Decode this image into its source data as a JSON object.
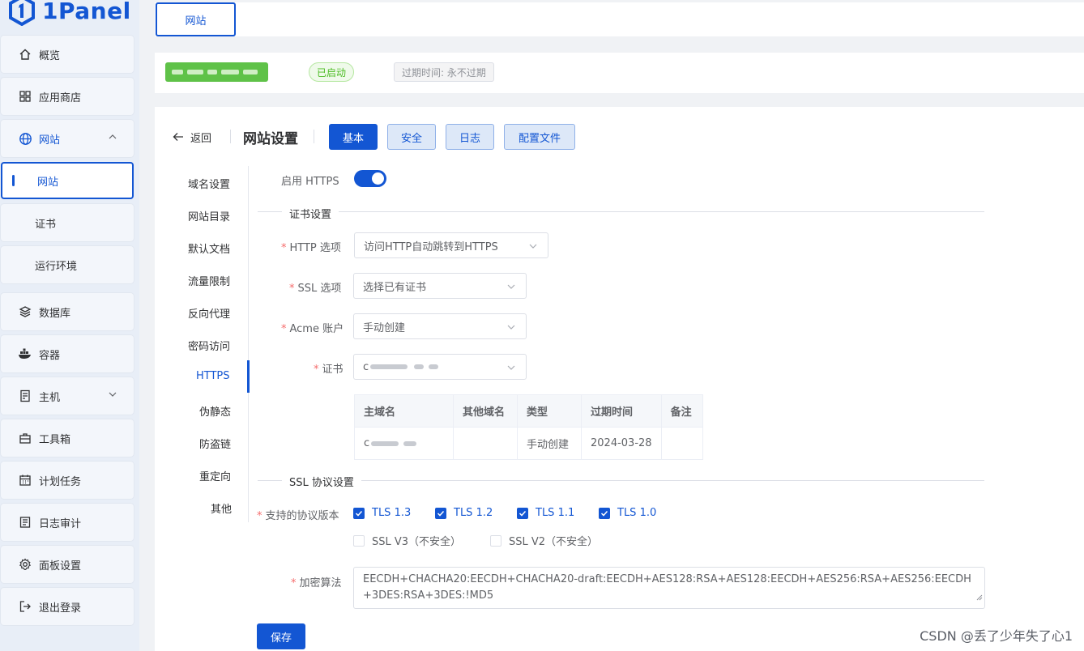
{
  "app": {
    "logo_text": "1Panel",
    "brand_color": "#1356d3"
  },
  "sidebar": {
    "items": [
      {
        "label": "概览",
        "icon": "home-icon"
      },
      {
        "label": "应用商店",
        "icon": "grid-icon"
      },
      {
        "label": "网站",
        "icon": "globe-icon",
        "expanded": true
      },
      {
        "label": "网站",
        "sub": true,
        "active": true
      },
      {
        "label": "证书",
        "sub": true
      },
      {
        "label": "运行环境",
        "sub": true
      },
      {
        "label": "数据库",
        "icon": "layers-icon"
      },
      {
        "label": "容器",
        "icon": "docker-icon"
      },
      {
        "label": "主机",
        "icon": "server-icon"
      },
      {
        "label": "工具箱",
        "icon": "toolbox-icon"
      },
      {
        "label": "计划任务",
        "icon": "calendar-icon"
      },
      {
        "label": "日志审计",
        "icon": "log-icon"
      },
      {
        "label": "面板设置",
        "icon": "gear-icon"
      },
      {
        "label": "退出登录",
        "icon": "logout-icon"
      }
    ]
  },
  "tabs": [
    {
      "label": "网站"
    }
  ],
  "site": {
    "status": "已启动",
    "expire": "过期时间: 永不过期"
  },
  "header": {
    "back_label": "返回",
    "title": "网站设置",
    "buttons": [
      "基本",
      "安全",
      "日志",
      "配置文件"
    ]
  },
  "submenu": [
    "域名设置",
    "网站目录",
    "默认文档",
    "流量限制",
    "反向代理",
    "密码访问",
    "HTTPS",
    "伪静态",
    "防盗链",
    "重定向",
    "其他"
  ],
  "https": {
    "enable_label": "启用 HTTPS",
    "enabled": true,
    "cert_section": "证书设置",
    "http_option_label": "HTTP 选项",
    "http_option_value": "访问HTTP自动跳转到HTTPS",
    "ssl_option_label": "SSL 选项",
    "ssl_option_value": "选择已有证书",
    "acme_label": "Acme 账户",
    "acme_value": "手动创建",
    "cert_label": "证书",
    "cert_value_prefix": "c",
    "table": {
      "headers": [
        "主域名",
        "其他域名",
        "类型",
        "过期时间",
        "备注"
      ],
      "rows": [
        {
          "domain_prefix": "c",
          "other": "",
          "type": "手动创建",
          "expire": "2024-03-28",
          "note": ""
        }
      ]
    },
    "protocol_section": "SSL 协议设置",
    "protocol_label": "支持的协议版本",
    "protocols": [
      {
        "label": "TLS 1.3",
        "checked": true
      },
      {
        "label": "TLS 1.2",
        "checked": true
      },
      {
        "label": "TLS 1.1",
        "checked": true
      },
      {
        "label": "TLS 1.0",
        "checked": true
      },
      {
        "label": "SSL V3（不安全）",
        "checked": false
      },
      {
        "label": "SSL V2（不安全）",
        "checked": false
      }
    ],
    "cipher_label": "加密算法",
    "cipher_value": "EECDH+CHACHA20:EECDH+CHACHA20-draft:EECDH+AES128:RSA+AES128:EECDH+AES256:RSA+AES256:EECDH+3DES:RSA+3DES:!MD5",
    "save_label": "保存"
  },
  "watermark": "CSDN @丢了少年失了心1"
}
